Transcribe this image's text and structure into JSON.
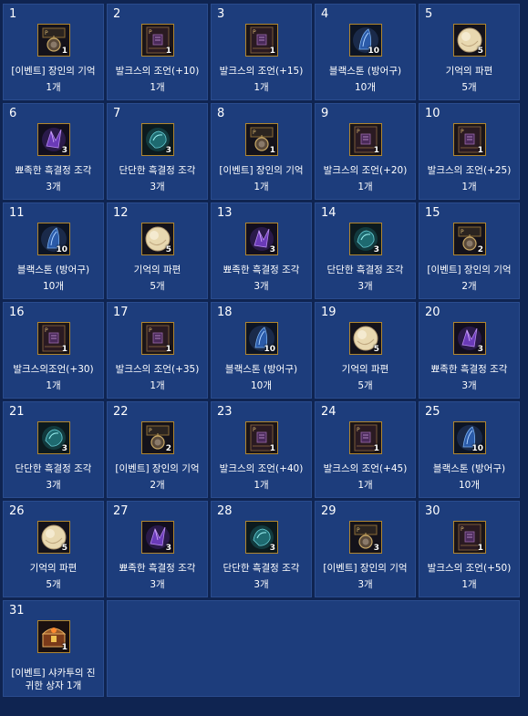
{
  "items": [
    {
      "num": "1",
      "icon": "memory-pendant-icon",
      "qty": "1",
      "name": "[이벤트] 장인의 기억",
      "count": "1개"
    },
    {
      "num": "2",
      "icon": "scroll-icon",
      "qty": "1",
      "name": "발크스의 조언(+10)",
      "count": "1개"
    },
    {
      "num": "3",
      "icon": "scroll-icon",
      "qty": "1",
      "name": "발크스의 조언(+15)",
      "count": "1개"
    },
    {
      "num": "4",
      "icon": "blackstone-armor-icon",
      "qty": "10",
      "name": "블랙스톤 (방어구)",
      "count": "10개"
    },
    {
      "num": "5",
      "icon": "memory-fragment-icon",
      "qty": "5",
      "name": "기억의 파편",
      "count": "5개"
    },
    {
      "num": "6",
      "icon": "sharp-crystal-shard-icon",
      "qty": "3",
      "name": "뾰족한 흑결정 조각",
      "count": "3개"
    },
    {
      "num": "7",
      "icon": "hard-crystal-shard-icon",
      "qty": "3",
      "name": "단단한 흑결정 조각",
      "count": "3개"
    },
    {
      "num": "8",
      "icon": "memory-pendant-icon",
      "qty": "1",
      "name": "[이벤트] 장인의 기억",
      "count": "1개"
    },
    {
      "num": "9",
      "icon": "scroll-icon",
      "qty": "1",
      "name": "발크스의 조언(+20)",
      "count": "1개"
    },
    {
      "num": "10",
      "icon": "scroll-icon",
      "qty": "1",
      "name": "발크스의 조언(+25)",
      "count": "1개"
    },
    {
      "num": "11",
      "icon": "blackstone-armor-icon",
      "qty": "10",
      "name": "블랙스톤 (방어구)",
      "count": "10개"
    },
    {
      "num": "12",
      "icon": "memory-fragment-icon",
      "qty": "5",
      "name": "기억의 파편",
      "count": "5개"
    },
    {
      "num": "13",
      "icon": "sharp-crystal-shard-icon",
      "qty": "3",
      "name": "뾰족한 흑결정 조각",
      "count": "3개"
    },
    {
      "num": "14",
      "icon": "hard-crystal-shard-icon",
      "qty": "3",
      "name": "단단한 흑결정 조각",
      "count": "3개"
    },
    {
      "num": "15",
      "icon": "memory-pendant-icon",
      "qty": "2",
      "name": "[이벤트] 장인의 기억",
      "count": "2개"
    },
    {
      "num": "16",
      "icon": "scroll-icon",
      "qty": "1",
      "name": "발크스의조언(+30)",
      "count": "1개"
    },
    {
      "num": "17",
      "icon": "scroll-icon",
      "qty": "1",
      "name": "발크스의 조언(+35)",
      "count": "1개"
    },
    {
      "num": "18",
      "icon": "blackstone-armor-icon",
      "qty": "10",
      "name": "블랙스톤 (방어구)",
      "count": "10개"
    },
    {
      "num": "19",
      "icon": "memory-fragment-icon",
      "qty": "5",
      "name": "기억의 파편",
      "count": "5개"
    },
    {
      "num": "20",
      "icon": "sharp-crystal-shard-icon",
      "qty": "3",
      "name": "뾰족한 흑결정 조각",
      "count": "3개"
    },
    {
      "num": "21",
      "icon": "hard-crystal-shard-icon",
      "qty": "3",
      "name": "단단한 흑결정 조각",
      "count": "3개"
    },
    {
      "num": "22",
      "icon": "memory-pendant-icon",
      "qty": "2",
      "name": "[이벤트] 장인의 기억",
      "count": "2개"
    },
    {
      "num": "23",
      "icon": "scroll-icon",
      "qty": "1",
      "name": "발크스의 조언(+40)",
      "count": "1개"
    },
    {
      "num": "24",
      "icon": "scroll-icon",
      "qty": "1",
      "name": "발크스의 조언(+45)",
      "count": "1개"
    },
    {
      "num": "25",
      "icon": "blackstone-armor-icon",
      "qty": "10",
      "name": "블랙스톤 (방어구)",
      "count": "10개"
    },
    {
      "num": "26",
      "icon": "memory-fragment-icon",
      "qty": "5",
      "name": "기억의 파편",
      "count": "5개"
    },
    {
      "num": "27",
      "icon": "sharp-crystal-shard-icon",
      "qty": "3",
      "name": "뾰족한 흑결정 조각",
      "count": "3개"
    },
    {
      "num": "28",
      "icon": "hard-crystal-shard-icon",
      "qty": "3",
      "name": "단단한 흑결정 조각",
      "count": "3개"
    },
    {
      "num": "29",
      "icon": "memory-pendant-icon",
      "qty": "3",
      "name": "[이벤트] 장인의 기억",
      "count": "3개"
    },
    {
      "num": "30",
      "icon": "scroll-icon",
      "qty": "1",
      "name": "발크스의 조언(+50)",
      "count": "1개"
    },
    {
      "num": "31",
      "icon": "treasure-chest-icon",
      "qty": "1",
      "name": "[이벤트] 샤카투의 진귀한 상자 1개",
      "count": "",
      "multiline": true
    }
  ],
  "colors": {
    "page_background": "#0f2451",
    "cell_background": "#1d3d7c",
    "cell_border": "#2a4c8e",
    "icon_border": "#b0862f"
  }
}
